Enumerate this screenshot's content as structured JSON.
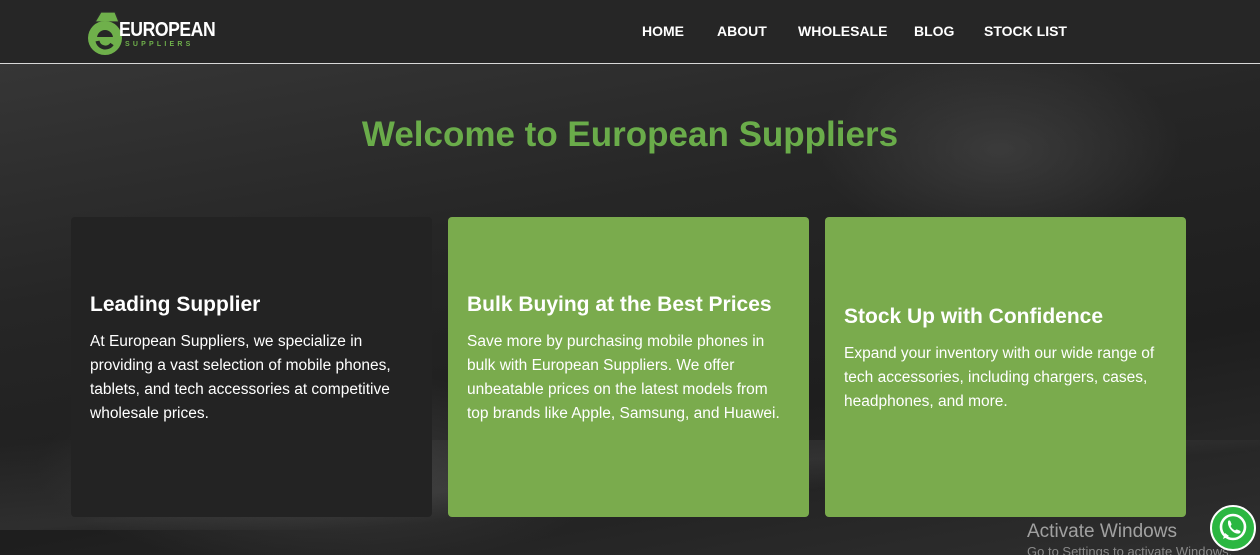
{
  "header": {
    "logo": {
      "main": "EUROPEAN",
      "sub": "SUPPLIERS",
      "icon": "shopping-bag-e-icon",
      "brand_green": "#6fb04b"
    },
    "nav": [
      {
        "label": "HOME"
      },
      {
        "label": "ABOUT"
      },
      {
        "label": "WHOLESALE"
      },
      {
        "label": "BLOG"
      },
      {
        "label": "STOCK LIST"
      }
    ]
  },
  "hero": {
    "title": "Welcome to European Suppliers",
    "title_color": "#6aac4a"
  },
  "cards": [
    {
      "title": "Leading Supplier",
      "text": "At European Suppliers, we specialize in providing a vast selection of mobile phones, tablets, and tech accessories at competitive wholesale prices.",
      "background": "#232323"
    },
    {
      "title": "Bulk Buying at the Best Prices",
      "text": "Save more by purchasing mobile phones in bulk with European Suppliers. We offer unbeatable prices on the latest models from top brands like Apple, Samsung, and Huawei.",
      "background": "#7aab4d"
    },
    {
      "title": "Stock Up with Confidence",
      "text": "Expand your inventory with our wide range of tech accessories, including chargers, cases, headphones, and more.",
      "background": "#7aab4d"
    }
  ],
  "overlay": {
    "activate_title": "Activate Windows",
    "activate_sub": "Go to Settings to activate Windows.",
    "whatsapp_icon": "whatsapp-icon",
    "whatsapp_color": "#2bb741"
  }
}
